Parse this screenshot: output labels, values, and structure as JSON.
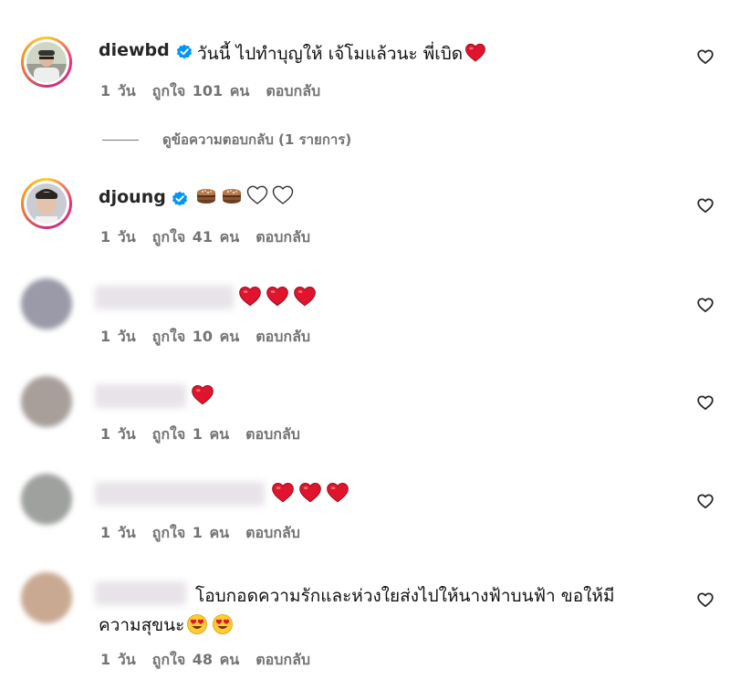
{
  "comments": [
    {
      "username": "diewbd",
      "text": "วันนี้ ไปทำบุญให้ เจ้โมแล้วนะ พี่เบิด",
      "meta": {
        "time": "1 วัน",
        "likes": "ถูกใจ 101 คน",
        "reply": "ตอบกลับ"
      },
      "view_replies": "ดูข้อความตอบกลับ (1 รายการ)"
    },
    {
      "username": "djoung",
      "text": "",
      "meta": {
        "time": "1 วัน",
        "likes": "ถูกใจ 41 คน",
        "reply": "ตอบกลับ"
      }
    },
    {
      "username": "",
      "text": "",
      "meta": {
        "time": "1 วัน",
        "likes": "ถูกใจ 10 คน",
        "reply": "ตอบกลับ"
      }
    },
    {
      "username": "",
      "text": "",
      "meta": {
        "time": "1 วัน",
        "likes": "ถูกใจ 1 คน",
        "reply": "ตอบกลับ"
      }
    },
    {
      "username": "",
      "text": "",
      "meta": {
        "time": "1 วัน",
        "likes": "ถูกใจ 1 คน",
        "reply": "ตอบกลับ"
      }
    },
    {
      "username": "",
      "text_line1": "โอบกอดความรักและห่วงใยส่งไปให้นางฟ้าบนฟ้า ขอให้มี",
      "text_line2": "ความสุขนะ",
      "meta": {
        "time": "1 วัน",
        "likes": "ถูกใจ 48 คน",
        "reply": "ตอบกลับ"
      }
    }
  ],
  "colors": {
    "heart": "#e0142c",
    "verified": "#0095f6",
    "meta": "#737373"
  },
  "icons": [
    "heart-emoji",
    "cake-emoji",
    "white-heart-emoji",
    "heart-eyes-emoji",
    "like-heart-outline-icon",
    "verified-badge-icon"
  ]
}
